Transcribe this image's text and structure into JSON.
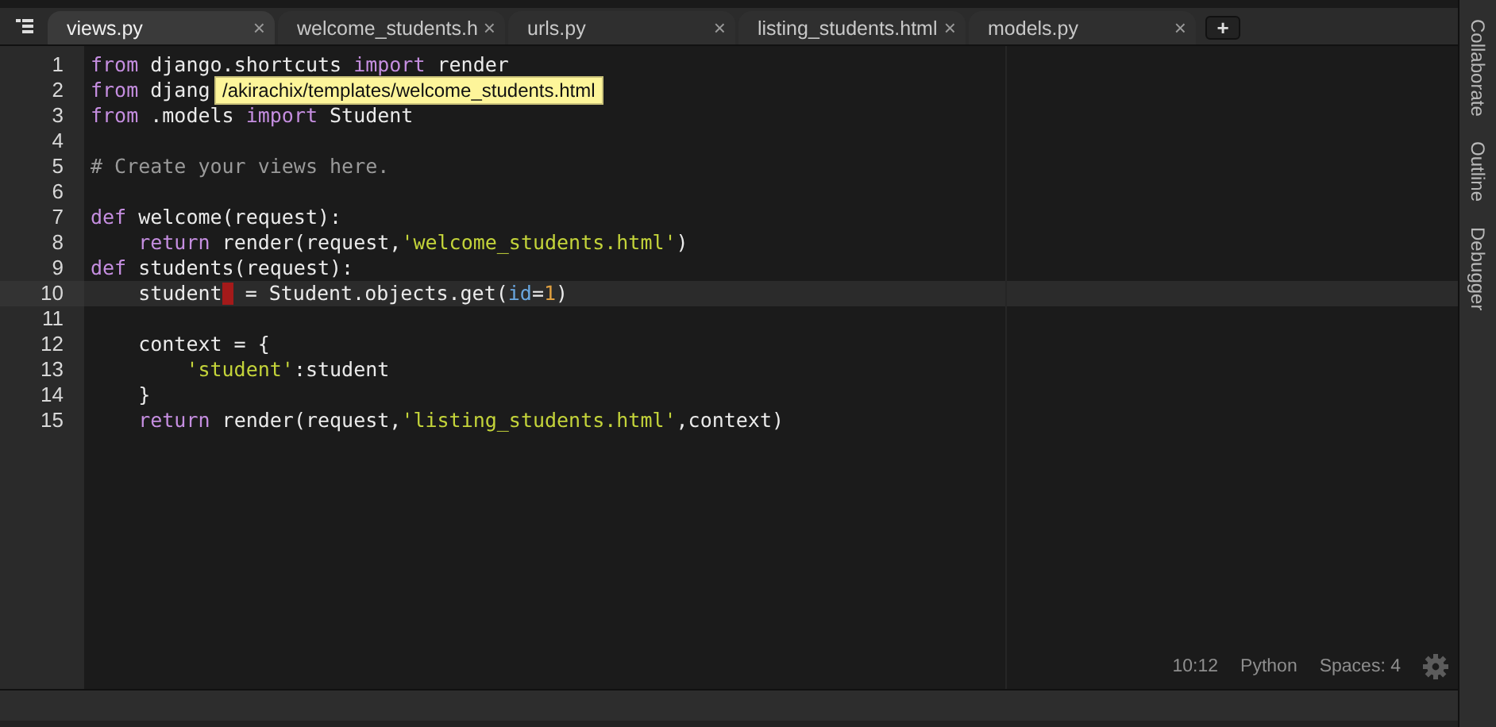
{
  "tabs": [
    {
      "label": "views.py",
      "selected": true,
      "close": "×"
    },
    {
      "label": "welcome_students.h",
      "selected": false,
      "close": "×"
    },
    {
      "label": "urls.py",
      "selected": false,
      "close": "×"
    },
    {
      "label": "listing_students.html",
      "selected": false,
      "close": "×"
    },
    {
      "label": "models.py",
      "selected": false,
      "close": "×"
    }
  ],
  "new_tab": "+",
  "editor": {
    "lines": [
      {
        "number": "1",
        "current": false,
        "tokens": [
          {
            "kind": "keyword",
            "text": "from"
          },
          {
            "kind": "plain",
            "text": " django.shortcuts "
          },
          {
            "kind": "keyword",
            "text": "import"
          },
          {
            "kind": "plain",
            "text": " render"
          }
        ]
      },
      {
        "number": "2",
        "current": false,
        "tokens": [
          {
            "kind": "keyword",
            "text": "from"
          },
          {
            "kind": "plain",
            "text": " djang"
          }
        ]
      },
      {
        "number": "3",
        "current": false,
        "tokens": [
          {
            "kind": "keyword",
            "text": "from"
          },
          {
            "kind": "plain",
            "text": " .models "
          },
          {
            "kind": "keyword",
            "text": "import"
          },
          {
            "kind": "plain",
            "text": " Student"
          }
        ]
      },
      {
        "number": "4",
        "current": false
      },
      {
        "number": "5",
        "current": false,
        "tokens": [
          {
            "kind": "comment",
            "text": "# Create your views here."
          }
        ]
      },
      {
        "number": "6",
        "current": false
      },
      {
        "number": "7",
        "current": false,
        "tokens": [
          {
            "kind": "keyword",
            "text": "def"
          },
          {
            "kind": "plain",
            "text": " welcome(request):"
          }
        ]
      },
      {
        "number": "8",
        "current": false,
        "tokens": [
          {
            "kind": "keyword",
            "text": "    return"
          },
          {
            "kind": "plain",
            "text": " render(request,"
          },
          {
            "kind": "string",
            "text": "'welcome_students.html'"
          },
          {
            "kind": "plain",
            "text": ")"
          }
        ]
      },
      {
        "number": "9",
        "current": false,
        "tokens": [
          {
            "kind": "keyword",
            "text": "def"
          },
          {
            "kind": "plain",
            "text": " students(request):"
          }
        ]
      },
      {
        "number": "10",
        "current": true,
        "tokens": [
          {
            "kind": "plain",
            "text": "    student",
            "cursor_after": true
          },
          {
            "kind": "plain",
            "text": " = Student.objects.get("
          },
          {
            "kind": "param",
            "text": "id"
          },
          {
            "kind": "plain",
            "text": "="
          },
          {
            "kind": "number",
            "text": "1"
          },
          {
            "kind": "plain",
            "text": ")"
          }
        ]
      },
      {
        "number": "11",
        "current": false
      },
      {
        "number": "12",
        "current": false,
        "tokens": [
          {
            "kind": "plain",
            "text": "    context = {"
          }
        ]
      },
      {
        "number": "13",
        "current": false,
        "tokens": [
          {
            "kind": "string",
            "text": "        'student'"
          },
          {
            "kind": "plain",
            "text": ":student"
          }
        ]
      },
      {
        "number": "14",
        "current": false,
        "tokens": [
          {
            "kind": "plain",
            "text": "    }"
          }
        ]
      },
      {
        "number": "15",
        "current": false,
        "tokens": [
          {
            "kind": "keyword",
            "text": "    return"
          },
          {
            "kind": "plain",
            "text": " render(request,"
          },
          {
            "kind": "string",
            "text": "'listing_students.html'"
          },
          {
            "kind": "plain",
            "text": ",context)"
          }
        ]
      }
    ]
  },
  "tooltip": "/akirachix/templates/welcome_students.html",
  "status": {
    "position": "10:12",
    "language": "Python",
    "indent": "Spaces: 4"
  },
  "side_panels": [
    "Collaborate",
    "Outline",
    "Debugger"
  ]
}
